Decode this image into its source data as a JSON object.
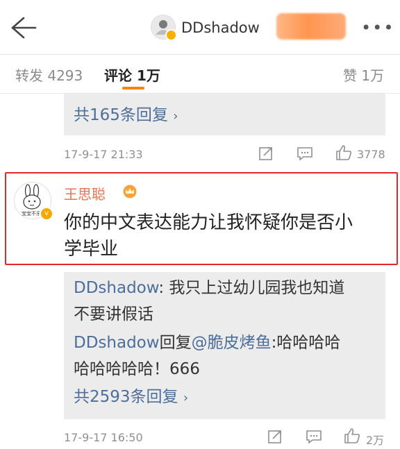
{
  "header": {
    "username": "DDshadow",
    "more_icon": "more-icon"
  },
  "tabs": [
    {
      "label": "转发 4293"
    },
    {
      "label": "评论 1万"
    },
    {
      "label": "赞 1万"
    }
  ],
  "thread1": {
    "reply_count_link": "共165条回复",
    "timestamp": "17-9-17 21:33",
    "like_count": "3778"
  },
  "highlighted_comment": {
    "author": "王思聪",
    "text_line1": "你的中文表达能力让我怀疑你是否小",
    "text_line2": "学毕业",
    "avatar_text": "宝宝不乐"
  },
  "replies": {
    "r1_author": "DDshadow",
    "r1_text_line1": ": 我只上过幼儿园我也知道",
    "r1_text_line2": "不要讲假话",
    "r2_author": "DDshadow",
    "r2_reply_word": "回复",
    "r2_mention": "@脆皮烤鱼",
    "r2_text_line1": ":哈哈哈哈",
    "r2_text_line2": "哈哈哈哈哈！666",
    "reply_count_link": "共2593条回复"
  },
  "thread2": {
    "timestamp": "17-9-17 16:50",
    "like_count": "2万"
  },
  "colors": {
    "accent": "#ff8200",
    "link_blue": "#4c6e9b",
    "author_orange": "#eb7350",
    "highlight_red": "#e3262b"
  }
}
